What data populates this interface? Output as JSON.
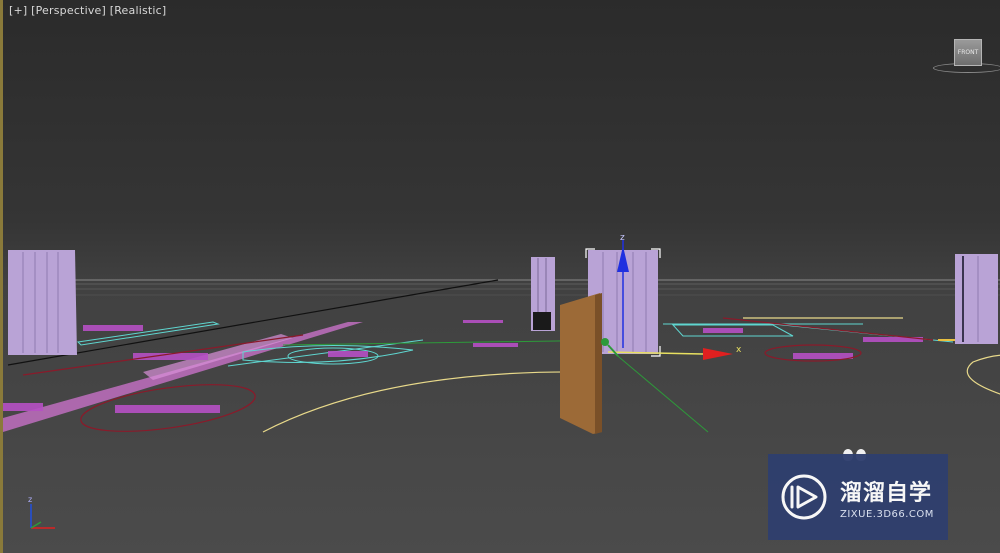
{
  "viewport": {
    "label_plus": "[+]",
    "label_view": "[Perspective]",
    "label_shading": "[Realistic]"
  },
  "viewcube": {
    "face_label": "FRONT"
  },
  "gizmo": {
    "x_label": "x",
    "z_label": "z"
  },
  "axis_tripod": {
    "z_label": "z"
  },
  "watermark": {
    "title": "溜溜自学",
    "url": "ZIXUE.3D66.COM"
  },
  "colors": {
    "column": "#b9a3d6",
    "column_shadow": "#8e7bb0",
    "board": "#9c6a37",
    "magenta": "#c860c8",
    "cyan": "#5fd6d0",
    "yellow_line": "#e8d98a",
    "dark_red": "#8a1a2a",
    "green_line": "#2d9a3a",
    "axis_red": "#e02020",
    "axis_blue": "#2030e0"
  }
}
